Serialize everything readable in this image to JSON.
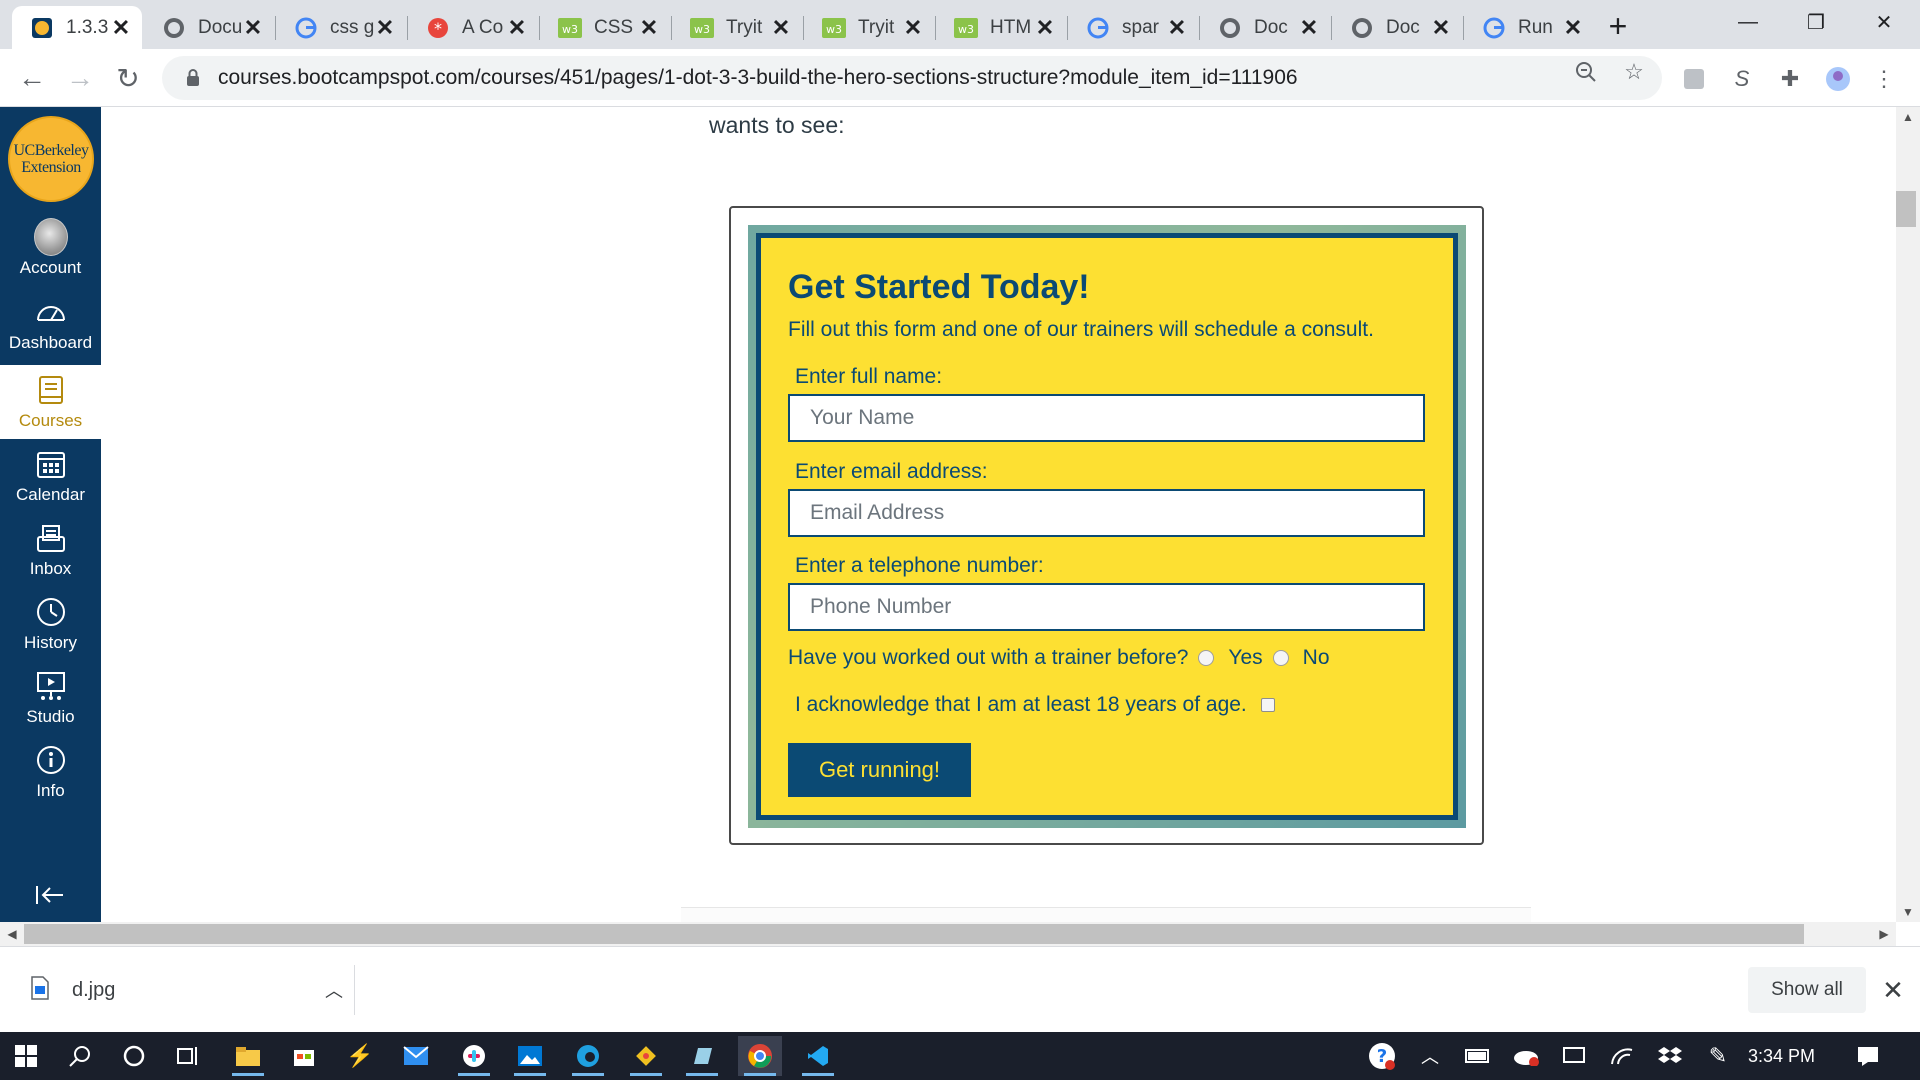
{
  "browser": {
    "tabs": [
      {
        "title": "1.3.3",
        "icon": "canvas-logo-icon"
      },
      {
        "title": "Docu",
        "icon": "globe-icon"
      },
      {
        "title": "css g",
        "icon": "google-icon"
      },
      {
        "title": "A Co",
        "icon": "asterisk-icon"
      },
      {
        "title": "CSS",
        "icon": "w3schools-icon"
      },
      {
        "title": "Tryit",
        "icon": "w3schools-icon"
      },
      {
        "title": "Tryit",
        "icon": "w3schools-icon"
      },
      {
        "title": "HTM",
        "icon": "w3schools-icon"
      },
      {
        "title": "spar",
        "icon": "google-icon"
      },
      {
        "title": "Doc",
        "icon": "globe-icon"
      },
      {
        "title": "Doc",
        "icon": "globe-icon"
      },
      {
        "title": "Run",
        "icon": "google-icon"
      }
    ],
    "url": "courses.bootcampspot.com/courses/451/pages/1-dot-3-3-build-the-hero-sections-structure?module_item_id=111906"
  },
  "sidebar": {
    "logo_lines": [
      "UCBerkeley",
      "Extension"
    ],
    "items": [
      {
        "label": "Account",
        "icon": "avatar-icon"
      },
      {
        "label": "Dashboard",
        "icon": "dashboard-icon"
      },
      {
        "label": "Courses",
        "icon": "courses-icon"
      },
      {
        "label": "Calendar",
        "icon": "calendar-icon"
      },
      {
        "label": "Inbox",
        "icon": "inbox-icon"
      },
      {
        "label": "History",
        "icon": "history-icon"
      },
      {
        "label": "Studio",
        "icon": "studio-icon"
      },
      {
        "label": "Info",
        "icon": "info-icon"
      }
    ]
  },
  "page": {
    "intro_text": "wants to see:",
    "hero": {
      "title": "Get Started Today!",
      "subtitle": "Fill out this form and one of our trainers will schedule a consult.",
      "name_label": "Enter full name:",
      "name_placeholder": "Your Name",
      "email_label": "Enter email address:",
      "email_placeholder": "Email Address",
      "phone_label": "Enter a telephone number:",
      "phone_placeholder": "Phone Number",
      "trainer_question": "Have you worked out with a trainer before?",
      "yes_label": "Yes",
      "no_label": "No",
      "age_ack": "I acknowledge that I am at least 18 years of age.",
      "submit_label": "Get running!"
    }
  },
  "downloads": {
    "file_name": "d.jpg",
    "show_all_label": "Show all"
  },
  "taskbar": {
    "time": "3:34 PM"
  },
  "colors": {
    "canvas_nav": "#0b3962",
    "hero_yellow": "#fde032",
    "hero_navy": "#0b4a74",
    "courses_active_text": "#b48a0e"
  }
}
